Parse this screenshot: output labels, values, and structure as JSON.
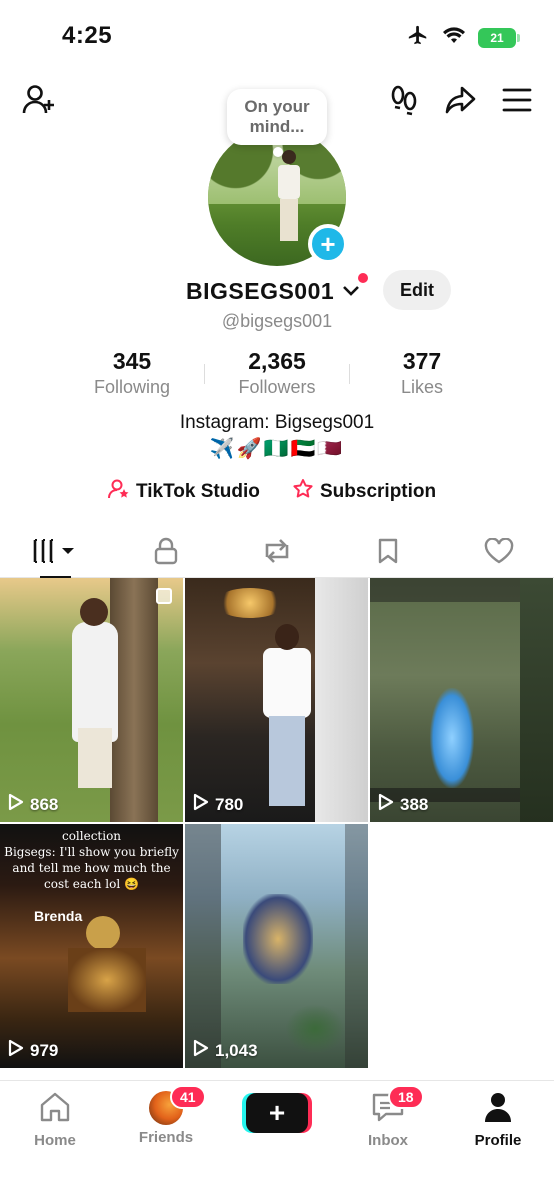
{
  "status_bar": {
    "time": "4:25",
    "battery": "21"
  },
  "bubble": {
    "text": "On your mind..."
  },
  "profile": {
    "username": "BIGSEGS001",
    "handle": "@bigsegs001",
    "edit_label": "Edit",
    "bio": "Instagram: Bigsegs001",
    "flags": "✈️🚀🇳🇬🇦🇪🇶🇦"
  },
  "stats": [
    {
      "value": "345",
      "label": "Following"
    },
    {
      "value": "2,365",
      "label": "Followers"
    },
    {
      "value": "377",
      "label": "Likes"
    }
  ],
  "links": {
    "studio": "TikTok Studio",
    "subscription": "Subscription"
  },
  "videos": [
    {
      "views": "868"
    },
    {
      "views": "780"
    },
    {
      "views": "388"
    },
    {
      "views": "979",
      "caption": "collection\nBigsegs: I'll show you briefly and tell me how much the cost each lol 😆",
      "overlay_name": "Brenda"
    },
    {
      "views": "1,043"
    }
  ],
  "nav": {
    "home": "Home",
    "friends": "Friends",
    "friends_badge": "41",
    "inbox": "Inbox",
    "inbox_badge": "18",
    "profile": "Profile"
  },
  "colors": {
    "accent": "#fe2c55",
    "cyan": "#25f4ee",
    "badge_blue": "#1fb8e8"
  }
}
